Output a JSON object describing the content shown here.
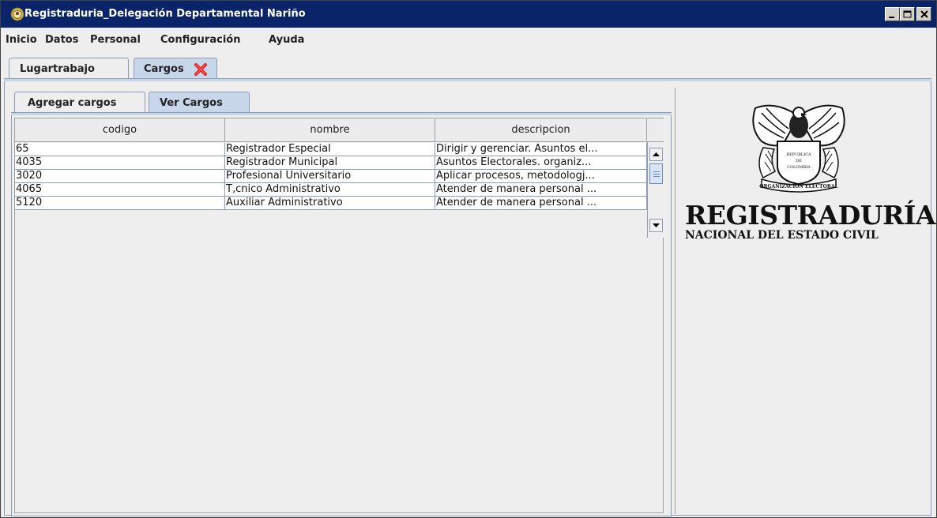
{
  "window": {
    "title": "Registraduria_Delegación Departamental Nariño",
    "app_icon": "registraduria-seal-icon",
    "controls": [
      "minimize-icon",
      "maximize-icon",
      "close-icon"
    ]
  },
  "menu": {
    "items": [
      "Inicio",
      "Datos",
      "Personal",
      "Configuración",
      "Ayuda"
    ]
  },
  "outer_tabs": [
    {
      "label": "Lugartrabajo",
      "selected": false
    },
    {
      "label": "Cargos",
      "selected": true,
      "close_icon": "red-x-close-icon"
    }
  ],
  "inner_tabs": [
    {
      "label": "Agregar cargos",
      "selected": false
    },
    {
      "label": "Ver Cargos",
      "selected": true
    }
  ],
  "table": {
    "columns": [
      "codigo",
      "nombre",
      "descripcion"
    ],
    "rows": [
      [
        "65",
        "Registrador Especial",
        "Dirigir y gerenciar. Asuntos el..."
      ],
      [
        "4035",
        "Registrador Municipal",
        "Asuntos Electorales. organiz..."
      ],
      [
        "3020",
        "Profesional Universitario",
        "Aplicar procesos, metodologj..."
      ],
      [
        "4065",
        "T‚cnico Administrativo",
        "Atender de manera personal ..."
      ],
      [
        "5120",
        "Auxiliar Administrativo",
        "Atender de manera personal ..."
      ]
    ]
  },
  "logo": {
    "line1": "REGISTRADURÍA",
    "line2": "NACIONAL DEL ESTADO CIVIL",
    "seal_text": [
      "REPUBLICA",
      "DE",
      "COLOMBIA",
      "ORGANIZACION ELECTORAL"
    ]
  },
  "colors": {
    "titlebar": "#0a246a",
    "tab_selected": "#c8d6ea",
    "close_x": "#e02020"
  }
}
